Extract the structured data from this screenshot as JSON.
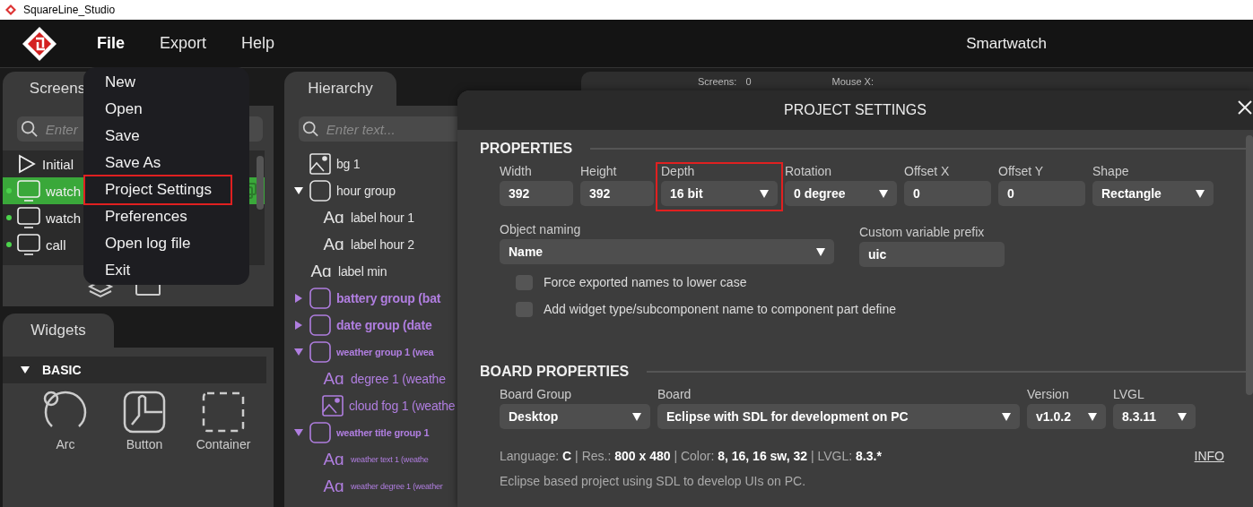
{
  "window": {
    "title": "SquareLine_Studio"
  },
  "menubar": {
    "items": [
      {
        "label": "File",
        "selected": true
      },
      {
        "label": "Export",
        "selected": false
      },
      {
        "label": "Help",
        "selected": false
      }
    ],
    "project": "Smartwatch"
  },
  "file_menu": {
    "items": [
      {
        "label": "New",
        "highlighted": false
      },
      {
        "label": "Open",
        "highlighted": false
      },
      {
        "label": "Save",
        "highlighted": false
      },
      {
        "label": "Save As",
        "highlighted": false
      },
      {
        "label": "Project Settings",
        "highlighted": true
      },
      {
        "label": "Preferences",
        "highlighted": false
      },
      {
        "label": "Open log file",
        "highlighted": false
      },
      {
        "label": "Exit",
        "highlighted": false
      }
    ]
  },
  "screens_panel": {
    "tab": "Screens",
    "search": {
      "placeholder": "Enter"
    },
    "items": [
      {
        "label": "Initial",
        "kind": "actions",
        "selected": false,
        "active": false
      },
      {
        "label": "watch",
        "kind": "screen",
        "selected": true,
        "active": true
      },
      {
        "label": "watch",
        "kind": "screen",
        "selected": false,
        "active": true
      },
      {
        "label": "call",
        "kind": "screen",
        "selected": false,
        "active": true
      }
    ]
  },
  "widgets_panel": {
    "tab": "Widgets",
    "section": {
      "label": "BASIC",
      "expanded": true
    },
    "items": [
      {
        "label": "Arc",
        "kind": "arc"
      },
      {
        "label": "Button",
        "kind": "button"
      },
      {
        "label": "Container",
        "kind": "container"
      }
    ]
  },
  "hierarchy_panel": {
    "tab": "Hierarchy",
    "search": {
      "placeholder": "Enter text..."
    },
    "items": [
      {
        "label": "bg 1",
        "kind": "image",
        "component": false,
        "compact": false
      },
      {
        "label": "hour group",
        "kind": "group",
        "component": false,
        "compact": false,
        "expanded": true,
        "children": [
          {
            "label": "label hour 1",
            "kind": "label",
            "glyph": "Aɑ",
            "component": false,
            "compact": false
          },
          {
            "label": "label hour 2",
            "kind": "label",
            "glyph": "Aɑ",
            "component": false,
            "compact": false
          }
        ]
      },
      {
        "label": "label min",
        "kind": "label",
        "glyph": "Aɑ",
        "component": false,
        "compact": false
      },
      {
        "label": "battery group (bat",
        "kind": "group",
        "component": true,
        "compact": false,
        "expanded": false
      },
      {
        "label": "date group (date",
        "kind": "group",
        "component": true,
        "compact": false,
        "expanded": false
      },
      {
        "label": "weather group 1 (wea",
        "kind": "group",
        "component": true,
        "compact": true,
        "expanded": true,
        "children": [
          {
            "label": "degree 1 (weathe",
            "kind": "label",
            "glyph": "Aɑ",
            "component": true,
            "compact": false
          },
          {
            "label": "cloud fog 1 (weathe",
            "kind": "image",
            "component": true,
            "compact": false
          }
        ]
      },
      {
        "label": "weather title group 1",
        "kind": "group",
        "component": true,
        "compact": true,
        "expanded": true,
        "children": [
          {
            "label": "weather text 1 (weathe",
            "kind": "label",
            "glyph": "Aɑ",
            "component": true,
            "compact": true
          },
          {
            "label": "weather degree 1 (weather",
            "kind": "label",
            "glyph": "Aɑ",
            "component": true,
            "compact": true
          }
        ]
      }
    ]
  },
  "toolbar": {
    "screens_label": "Screens:",
    "screens_count": "0",
    "mouse_x_label": "Mouse X:"
  },
  "dialog": {
    "title": "PROJECT SETTINGS",
    "properties": {
      "heading": "PROPERTIES",
      "fields": [
        {
          "label": "Width",
          "value": "392",
          "kind": "input",
          "highlighted": false
        },
        {
          "label": "Height",
          "value": "392",
          "kind": "input",
          "highlighted": false
        },
        {
          "label": "Depth",
          "value": "16 bit",
          "kind": "dropdown",
          "highlighted": true
        },
        {
          "label": "Rotation",
          "value": "0 degree",
          "kind": "dropdown",
          "highlighted": false
        },
        {
          "label": "Offset X",
          "value": "0",
          "kind": "input",
          "highlighted": false
        },
        {
          "label": "Offset Y",
          "value": "0",
          "kind": "input",
          "highlighted": false
        },
        {
          "label": "Shape",
          "value": "Rectangle",
          "kind": "dropdown",
          "highlighted": false
        }
      ],
      "object_naming": {
        "label": "Object naming",
        "value": "Name"
      },
      "prefix": {
        "label": "Custom variable prefix",
        "value": "uic"
      },
      "checkboxes": [
        {
          "label": "Force exported names to lower case",
          "checked": false
        },
        {
          "label": "Add widget type/subcomponent name to component part define",
          "checked": false
        }
      ]
    },
    "board": {
      "heading": "BOARD PROPERTIES",
      "fields": [
        {
          "label": "Board Group",
          "value": "Desktop"
        },
        {
          "label": "Board",
          "value": "Eclipse with SDL for development on PC"
        },
        {
          "label": "Version",
          "value": "v1.0.2"
        },
        {
          "label": "LVGL",
          "value": "8.3.11"
        }
      ],
      "info": [
        {
          "label": "Language:",
          "value": "C"
        },
        {
          "label": "Res.:",
          "value": "800 x 480"
        },
        {
          "label": "Color:",
          "value": "8, 16, 16 sw, 32"
        },
        {
          "label": "LVGL:",
          "value": "8.3.*"
        }
      ],
      "separator": "|",
      "info_link": "INFO",
      "description": "Eclipse based project using SDL to develop UIs on PC."
    }
  }
}
